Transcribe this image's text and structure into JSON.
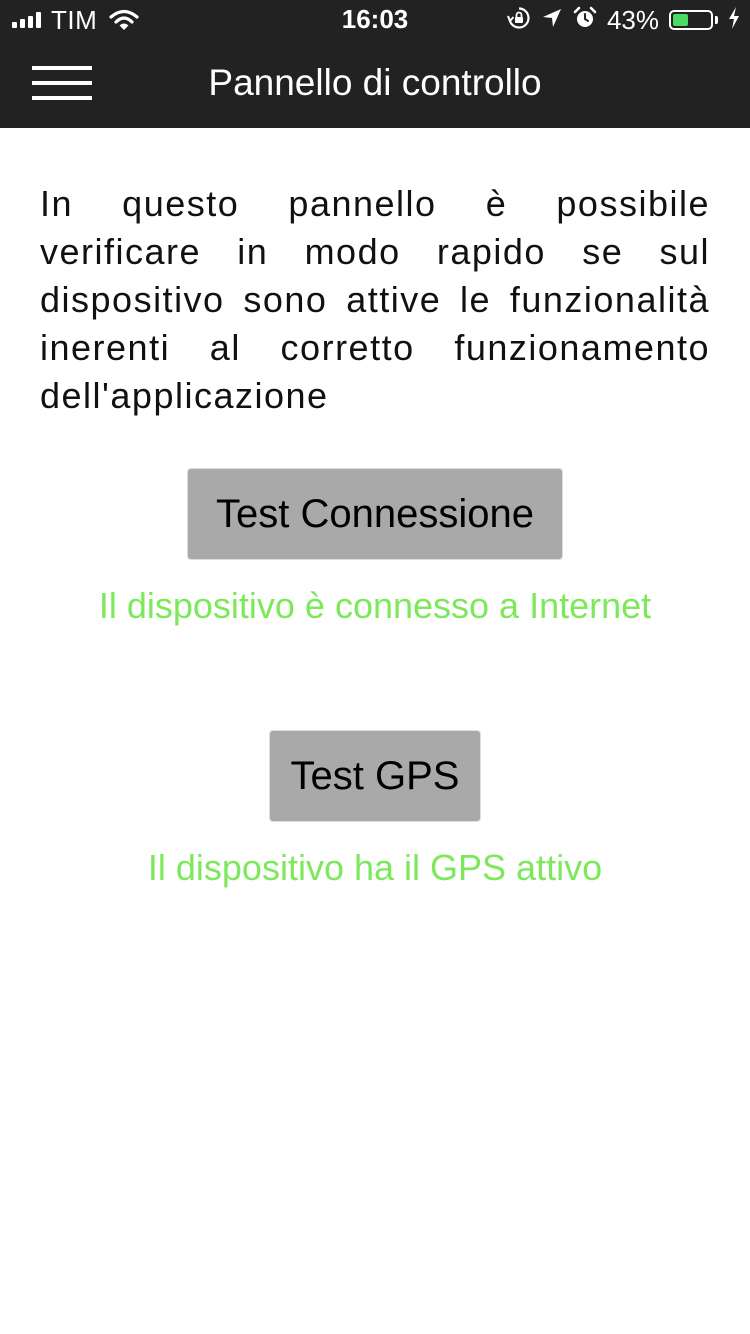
{
  "status_bar": {
    "carrier": "TIM",
    "time": "16:03",
    "battery_percent": "43%",
    "battery_level": 0.43,
    "charging": true,
    "icons": [
      "signal-icon",
      "wifi-icon",
      "rotation-lock-icon",
      "location-icon",
      "alarm-icon",
      "battery-icon",
      "charging-bolt-icon"
    ]
  },
  "header": {
    "title": "Pannello di controllo",
    "menu_icon": "hamburger-menu-icon"
  },
  "content": {
    "description": "In questo pannello è possibile verificare in modo rapido se sul dispositivo sono attive le funzionalità inerenti al corretto funzionamento dell'applicazione",
    "connection_test": {
      "button_label": "Test Connessione",
      "result": "Il dispositivo è connesso a Internet"
    },
    "gps_test": {
      "button_label": "Test GPS",
      "result": "Il dispositivo ha il GPS attivo"
    }
  },
  "colors": {
    "header_bg": "#222222",
    "button_bg": "#a9a9a9",
    "success_text": "#7ee85c",
    "battery_fill": "#4cd964"
  }
}
